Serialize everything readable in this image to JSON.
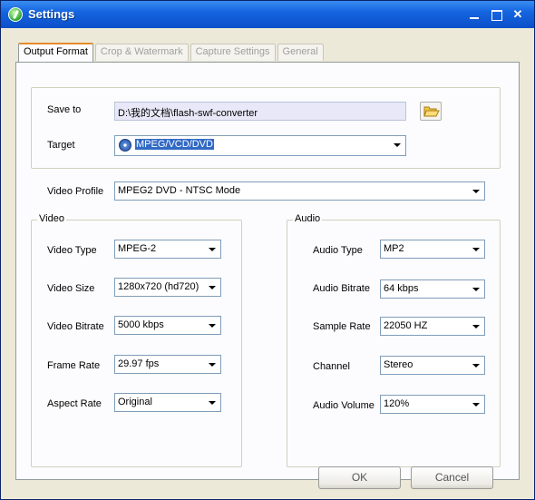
{
  "window": {
    "title": "Settings"
  },
  "tabs": [
    {
      "label": "Output Format",
      "active": true
    },
    {
      "label": "Crop & Watermark",
      "active": false
    },
    {
      "label": "Capture Settings",
      "active": false
    },
    {
      "label": "General",
      "active": false
    }
  ],
  "output": {
    "save_to_label": "Save to",
    "save_to_value": "D:\\我的文档\\flash-swf-converter",
    "target_label": "Target",
    "target_value": "MPEG/VCD/DVD",
    "video_profile_label": "Video Profile",
    "video_profile_value": "MPEG2  DVD - NTSC Mode"
  },
  "video": {
    "group_label": "Video",
    "type_label": "Video Type",
    "type_value": "MPEG-2",
    "size_label": "Video Size",
    "size_value": "1280x720 (hd720)",
    "bitrate_label": "Video Bitrate",
    "bitrate_value": "5000 kbps",
    "frame_rate_label": "Frame Rate",
    "frame_rate_value": "29.97 fps",
    "aspect_label": "Aspect Rate",
    "aspect_value": "Original"
  },
  "audio": {
    "group_label": "Audio",
    "type_label": "Audio Type",
    "type_value": "MP2",
    "bitrate_label": "Audio Bitrate",
    "bitrate_value": "64 kbps",
    "sample_label": "Sample Rate",
    "sample_value": "22050 HZ",
    "channel_label": "Channel",
    "channel_value": "Stereo",
    "volume_label": "Audio Volume",
    "volume_value": "120%"
  },
  "buttons": {
    "ok": "OK",
    "cancel": "Cancel"
  },
  "colors": {
    "titlebar": "#1565e0",
    "accent_tab": "#e68b2c",
    "selection": "#316ac5"
  }
}
